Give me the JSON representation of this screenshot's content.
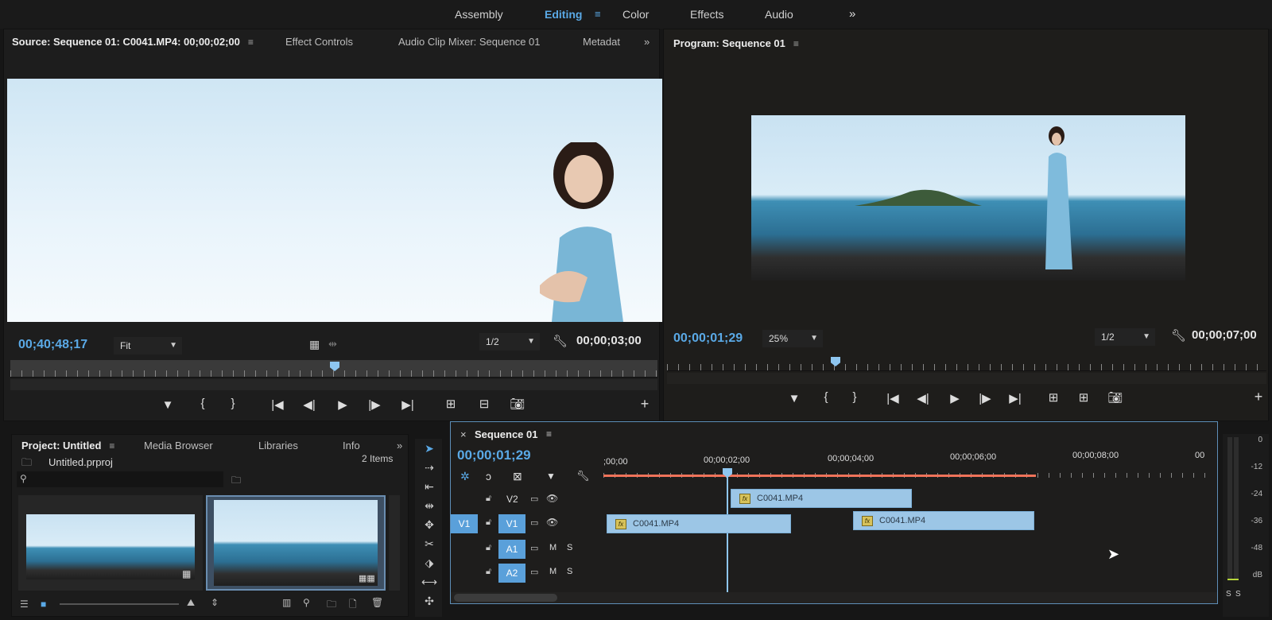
{
  "workspaces": {
    "items": [
      "Assembly",
      "Editing",
      "Color",
      "Effects",
      "Audio"
    ],
    "active": "Editing",
    "more": "»"
  },
  "source_panel": {
    "tabs": [
      "Source: Sequence 01: C0041.MP4: 00;00;02;00",
      "Effect Controls",
      "Audio Clip Mixer: Sequence 01",
      "Metadat"
    ],
    "menu_icon": "≡",
    "more": "»",
    "timecode_left": "00;40;48;17",
    "zoom": "Fit",
    "resolution": "1/2",
    "timecode_right": "00;00;03;00"
  },
  "program_panel": {
    "title": "Program: Sequence 01",
    "menu_icon": "≡",
    "timecode_left": "00;00;01;29",
    "zoom": "25%",
    "resolution": "1/2",
    "timecode_right": "00;00;07;00"
  },
  "transport": {
    "marker": "▼",
    "in": "{",
    "out": "}",
    "goto_in": "|◀",
    "step_back": "◀|",
    "play": "▶",
    "step_fwd": "|▶",
    "goto_out": "▶|",
    "add": "+"
  },
  "project_panel": {
    "tabs": [
      "Project: Untitled",
      "Media Browser",
      "Libraries",
      "Info"
    ],
    "more": "»",
    "file_name": "Untitled.prproj",
    "item_count": "2 Items"
  },
  "sequence_panel": {
    "close": "×",
    "title": "Sequence 01",
    "menu_icon": "≡",
    "timecode": "00;00;01;29",
    "ruler_labels": [
      ";00;00",
      "00;00;02;00",
      "00;00;04;00",
      "00;00;06;00",
      "00;00;08;00",
      "00"
    ],
    "tracks": [
      {
        "source": "",
        "name": "V2"
      },
      {
        "source": "V1",
        "name": "V1"
      },
      {
        "source": "",
        "name": "A1"
      },
      {
        "source": "",
        "name": "A2"
      }
    ],
    "track_buttons": {
      "mute": "M",
      "solo": "S"
    },
    "clips": {
      "v2_clip": "C0041.MP4",
      "v1_clip_a": "C0041.MP4",
      "v1_clip_b": "C0041.MP4"
    },
    "fx_badge": "fx"
  },
  "audio_meter": {
    "labels": [
      "0",
      "-12",
      "-24",
      "-36",
      "-48",
      "dB"
    ],
    "solo_labels": [
      "S",
      "S"
    ]
  }
}
